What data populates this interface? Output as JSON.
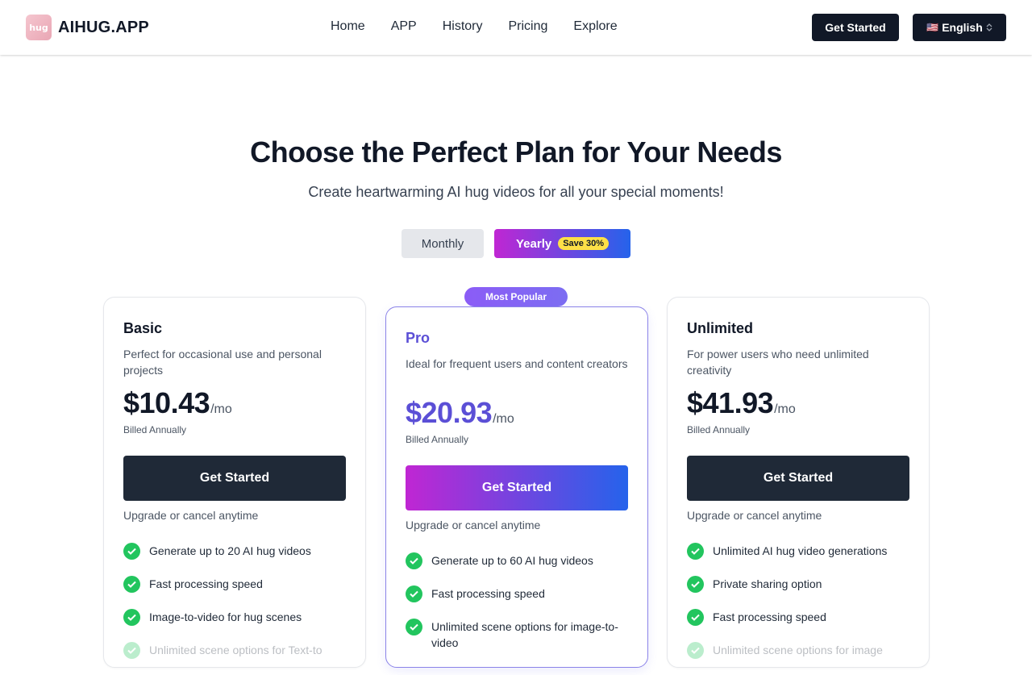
{
  "header": {
    "logo_text": "hug",
    "brand": "AIHUG.APP",
    "nav": [
      "Home",
      "APP",
      "History",
      "Pricing",
      "Explore"
    ],
    "cta": "Get Started",
    "language": {
      "flag": "🇺🇸",
      "label": "English"
    }
  },
  "hero": {
    "title": "Choose the Perfect Plan for Your Needs",
    "subtitle": "Create heartwarming AI hug videos for all your special moments!"
  },
  "billing_toggle": {
    "monthly": "Monthly",
    "yearly": "Yearly",
    "save_badge": "Save 30%",
    "selected": "Yearly"
  },
  "popular_badge": "Most Popular",
  "plans": [
    {
      "name": "Basic",
      "description": "Perfect for occasional use and personal projects",
      "price": "$10.43",
      "period": "/mo",
      "billed": "Billed Annually",
      "button": "Get Started",
      "note": "Upgrade or cancel anytime",
      "features": [
        "Generate up to 20 AI hug videos",
        "Fast processing speed",
        "Image-to-video for hug scenes",
        "Unlimited scene options for Text-to"
      ]
    },
    {
      "name": "Pro",
      "description": "Ideal for frequent users and content creators",
      "price": "$20.93",
      "period": "/mo",
      "billed": "Billed Annually",
      "button": "Get Started",
      "note": "Upgrade or cancel anytime",
      "features": [
        "Generate up to 60 AI hug videos",
        "Fast processing speed",
        "Unlimited scene options for image-to-video"
      ]
    },
    {
      "name": "Unlimited",
      "description": "For power users who need unlimited creativity",
      "price": "$41.93",
      "period": "/mo",
      "billed": "Billed Annually",
      "button": "Get Started",
      "note": "Upgrade or cancel anytime",
      "features": [
        "Unlimited AI hug video generations",
        "Private sharing option",
        "Fast processing speed",
        "Unlimited scene options for image"
      ]
    }
  ],
  "colors": {
    "accent_start": "#c026d3",
    "accent_end": "#2563eb",
    "pro": "#5b4fd6",
    "check": "#22c55e",
    "dark": "#1f2937"
  }
}
